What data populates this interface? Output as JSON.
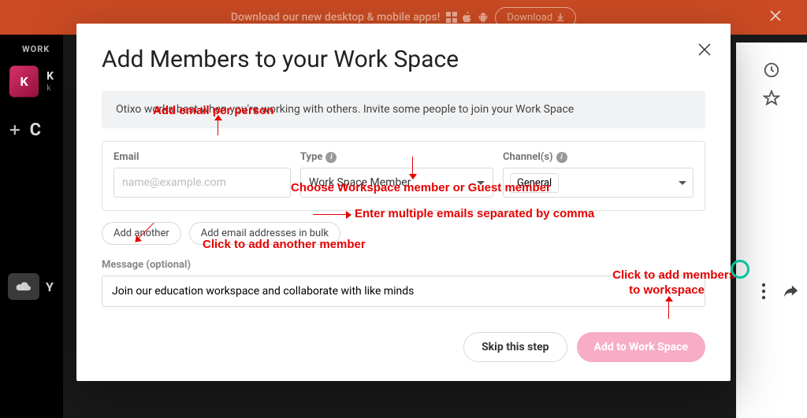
{
  "banner": {
    "text": "Download our new desktop & mobile apps!",
    "download_label": "Download"
  },
  "sidebar": {
    "heading": "WORK",
    "workspace": {
      "initial": "K",
      "name": "K",
      "sub": "k"
    },
    "create_label": "C",
    "your_label": "Y"
  },
  "modal": {
    "title": "Add Members to your Work Space",
    "info": "Otixo works best when you're working with others. Invite some people to join your Work Space",
    "email_label": "Email",
    "email_placeholder": "name@example.com",
    "type_label": "Type",
    "type_value": "Work Space Member",
    "channels_label": "Channel(s)",
    "channel_chip": "General",
    "add_another_label": "Add another",
    "add_bulk_label": "Add email addresses in bulk",
    "message_label": "Message (optional)",
    "message_value": "Join our education workspace and collaborate with like minds",
    "skip_label": "Skip this step",
    "submit_label": "Add to Work Space"
  },
  "annotations": {
    "a1": "Add email per person",
    "a2": "Choose Workspace member or Guest member",
    "a3": "Enter multiple emails separated by comma",
    "a4": "Click to add another member",
    "a5_line1": "Click to add members",
    "a5_line2": "to workspace"
  }
}
